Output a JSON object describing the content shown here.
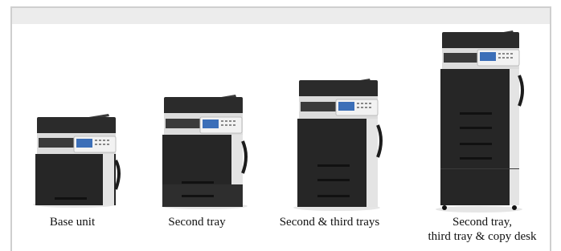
{
  "captions": {
    "base": "Base unit",
    "second": "Second tray",
    "second_third": "Second & third trays",
    "full_line1": "Second tray,",
    "full_line2": "third tray & copy desk"
  }
}
